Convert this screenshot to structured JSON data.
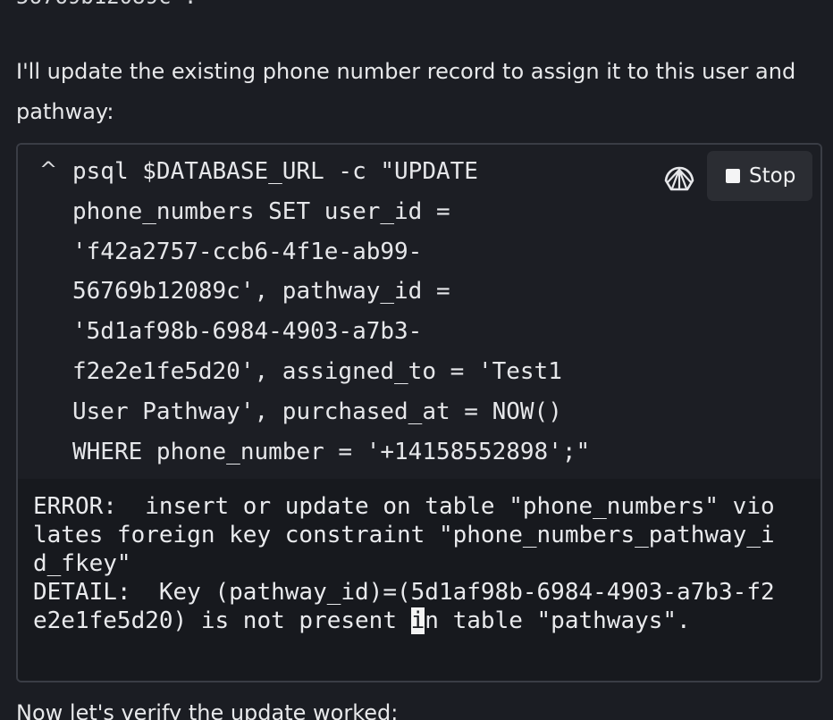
{
  "conversation": {
    "prev_fragment": "56769b12089c'.",
    "intro_message": "I'll update the existing phone number record to assign it to this user and\npathway:",
    "next_message": "Now let's verify the update worked:"
  },
  "tool_call": {
    "collapse_icon": "chevron-up-icon",
    "command": "psql $DATABASE_URL -c \"UPDATE\nphone_numbers SET user_id =\n'f42a2757-ccb6-4f1e-ab99-\n56769b12089c', pathway_id =\n'5d1af98b-6984-4903-a7b3-\nf2e2e1fe5d20', assigned_to = 'Test1\nUser Pathway', purchased_at = NOW()\nWHERE phone_number = '+14158552898';\"",
    "shell_icon": "shell-icon",
    "stop_label": "Stop",
    "output_before_cursor": "ERROR:  insert or update on table \"phone_numbers\" vio\nlates foreign key constraint \"phone_numbers_pathway_i\nd_fkey\"\nDETAIL:  Key (pathway_id)=(5d1af98b-6984-4903-a7b3-f2\ne2e1fe5d20) is not present ",
    "output_cursor_char": "i",
    "output_after_cursor": "n table \"pathways\"."
  }
}
